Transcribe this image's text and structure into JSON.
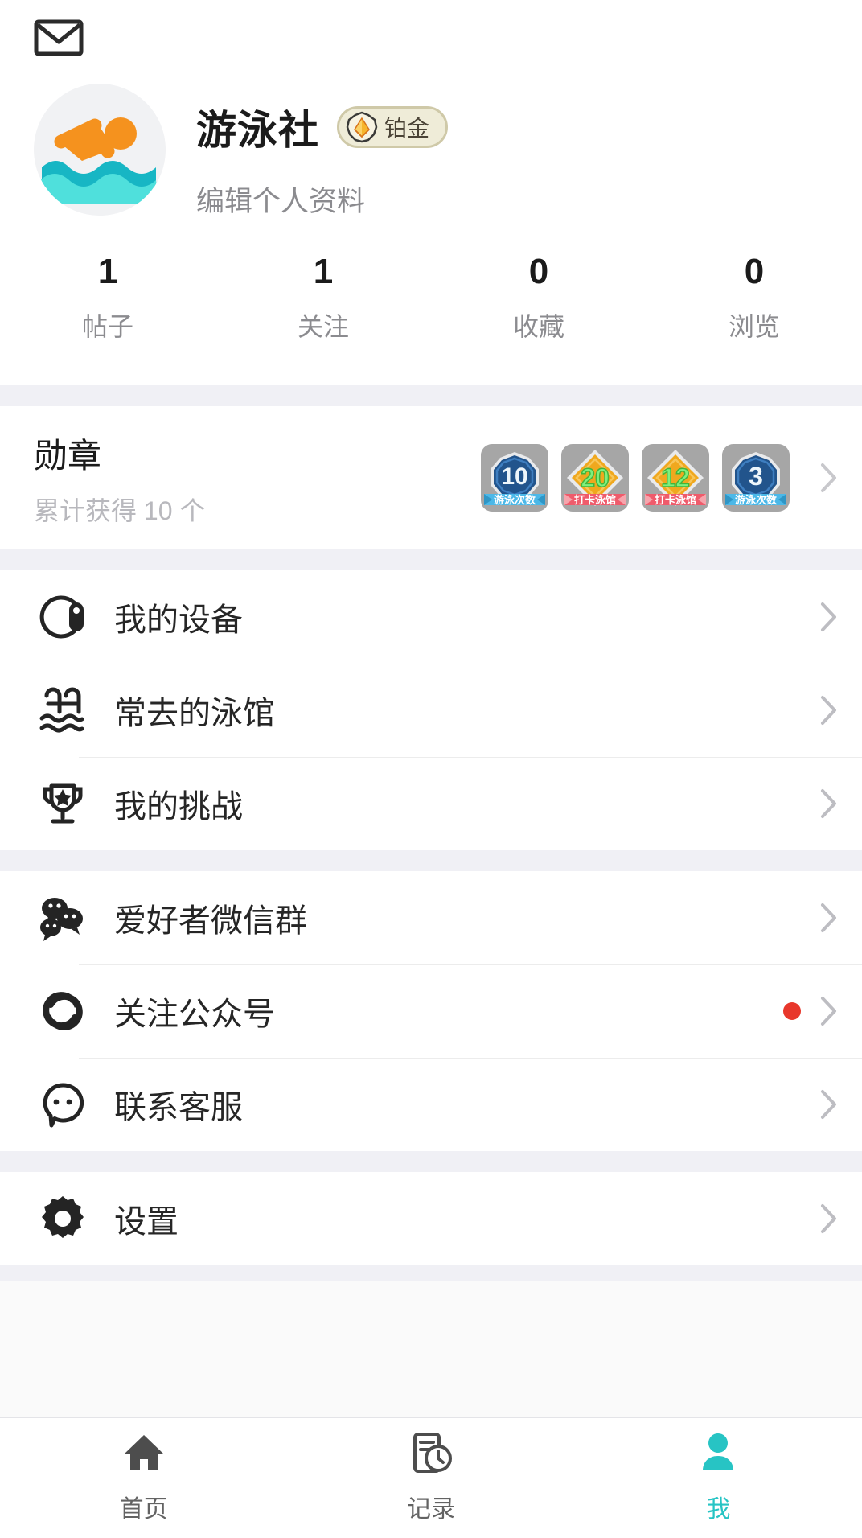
{
  "topbar": {
    "mail_icon": "mail-icon"
  },
  "profile": {
    "avatar_alt": "swimmer-avatar",
    "username": "游泳社",
    "rank_badge": {
      "label": "铂金",
      "icon": "gem-icon",
      "bg": "#efecd8",
      "border": "#cfc9a8"
    },
    "edit_label": "编辑个人资料"
  },
  "stats": [
    {
      "value": "1",
      "label": "帖子"
    },
    {
      "value": "1",
      "label": "关注"
    },
    {
      "value": "0",
      "label": "收藏"
    },
    {
      "value": "0",
      "label": "浏览"
    }
  ],
  "medals": {
    "title": "勋章",
    "subtitle": "累计获得 10 个",
    "chevron": "chevron-right-icon",
    "items": [
      {
        "number": "10",
        "ribbon": "游泳次数",
        "shape": "octagon",
        "color": "#22548c",
        "ribbon_color": "#4bb8e8",
        "number_color": "#eef6fb"
      },
      {
        "number": "20",
        "ribbon": "打卡泳馆",
        "shape": "diamond",
        "color": "#f0a81e",
        "ribbon_color": "#ef5b6b",
        "number_color": "#7ef07e"
      },
      {
        "number": "12",
        "ribbon": "打卡泳馆",
        "shape": "diamond",
        "color": "#f0a81e",
        "ribbon_color": "#ef5b6b",
        "number_color": "#7ef07e"
      },
      {
        "number": "3",
        "ribbon": "游泳次数",
        "shape": "octagon",
        "color": "#22548c",
        "ribbon_color": "#4bb8e8",
        "number_color": "#eef6fb"
      }
    ]
  },
  "menu_groups": [
    {
      "rows": [
        {
          "label": "我的设备",
          "icon": "watch-icon",
          "dot": false
        },
        {
          "label": "常去的泳馆",
          "icon": "pool-icon",
          "dot": false
        },
        {
          "label": "我的挑战",
          "icon": "trophy-icon",
          "dot": false
        }
      ]
    },
    {
      "rows": [
        {
          "label": "爱好者微信群",
          "icon": "wechat-icon",
          "dot": false
        },
        {
          "label": "关注公众号",
          "icon": "refresh-circle-icon",
          "dot": true
        },
        {
          "label": "联系客服",
          "icon": "chat-face-icon",
          "dot": false
        }
      ]
    },
    {
      "rows": [
        {
          "label": "设置",
          "icon": "gear-icon",
          "dot": false
        }
      ]
    }
  ],
  "bottom_nav": {
    "active_color": "#27c4c4",
    "items": [
      {
        "label": "首页",
        "icon": "home-icon",
        "active": false
      },
      {
        "label": "记录",
        "icon": "record-icon",
        "active": false
      },
      {
        "label": "我",
        "icon": "person-icon",
        "active": true
      }
    ]
  }
}
